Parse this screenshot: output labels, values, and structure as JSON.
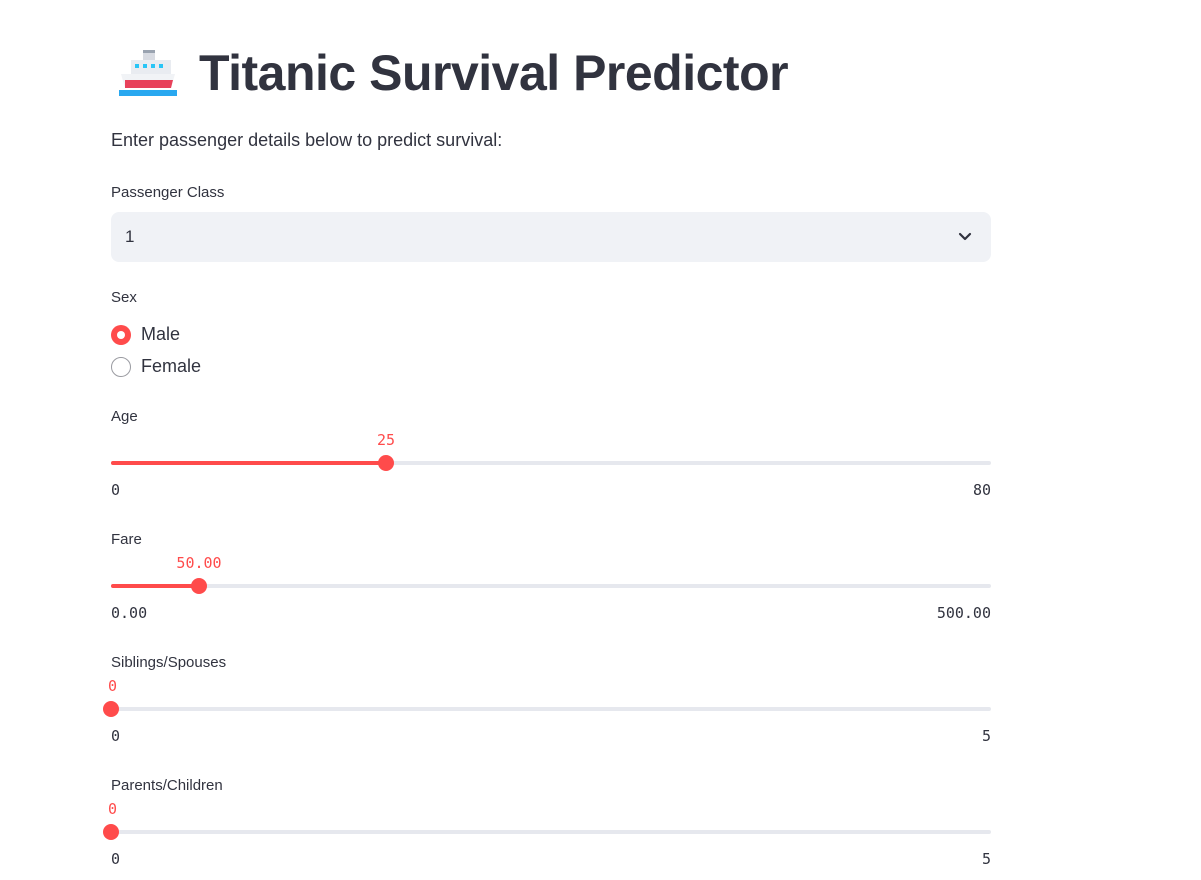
{
  "header": {
    "icon": "ship-icon",
    "title": "Titanic Survival Predictor",
    "intro": "Enter passenger details below to predict survival:"
  },
  "passenger_class": {
    "label": "Passenger Class",
    "selected": "1"
  },
  "sex": {
    "label": "Sex",
    "options": [
      {
        "label": "Male",
        "selected": true
      },
      {
        "label": "Female",
        "selected": false
      }
    ]
  },
  "age": {
    "label": "Age",
    "value": 25,
    "display": "25",
    "min": 0,
    "max": 80,
    "min_label": "0",
    "max_label": "80"
  },
  "fare": {
    "label": "Fare",
    "value": 50.0,
    "display": "50.00",
    "min": 0,
    "max": 500,
    "min_label": "0.00",
    "max_label": "500.00"
  },
  "siblings_spouses": {
    "label": "Siblings/Spouses",
    "value": 0,
    "display": "0",
    "min": 0,
    "max": 5,
    "min_label": "0",
    "max_label": "5"
  },
  "parents_children": {
    "label": "Parents/Children",
    "value": 0,
    "display": "0",
    "min": 0,
    "max": 5,
    "min_label": "0",
    "max_label": "5"
  },
  "colors": {
    "accent": "#ff4b4b",
    "text": "#31333f",
    "select_bg": "#f0f2f6",
    "track": "#e6e8ee"
  }
}
